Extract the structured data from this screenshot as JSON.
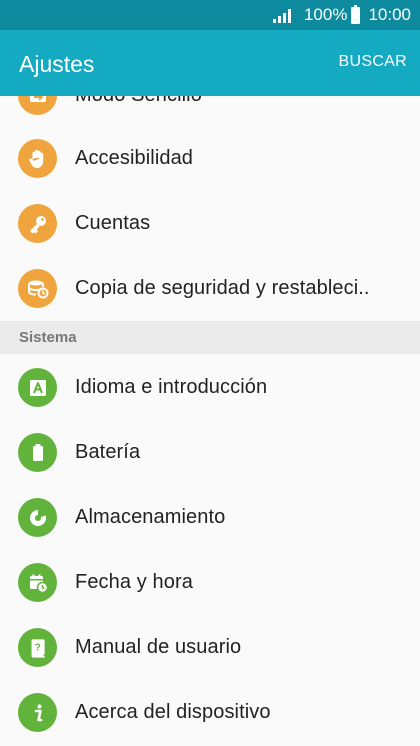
{
  "status_bar": {
    "battery": "100%",
    "time": "10:00"
  },
  "app_bar": {
    "title": "Ajustes",
    "search_label": "BUSCAR"
  },
  "personal_items": [
    {
      "label": "Modo Sencillo",
      "icon": "simple-mode-icon"
    },
    {
      "label": "Accesibilidad",
      "icon": "hand-icon"
    },
    {
      "label": "Cuentas",
      "icon": "key-icon"
    },
    {
      "label": "Copia de seguridad y restableci..",
      "icon": "backup-icon"
    }
  ],
  "section_system": "Sistema",
  "system_items": [
    {
      "label": "Idioma e introducción",
      "icon": "language-icon"
    },
    {
      "label": "Batería",
      "icon": "battery-icon"
    },
    {
      "label": "Almacenamiento",
      "icon": "storage-icon"
    },
    {
      "label": "Fecha y hora",
      "icon": "calendar-clock-icon"
    },
    {
      "label": "Manual de usuario",
      "icon": "manual-icon"
    },
    {
      "label": "Acerca del dispositivo",
      "icon": "info-icon"
    }
  ],
  "colors": {
    "status_bar": "#0d8a9e",
    "app_bar": "#13aac2",
    "orange_icon": "#f0a43d",
    "green_icon": "#62b33b"
  }
}
